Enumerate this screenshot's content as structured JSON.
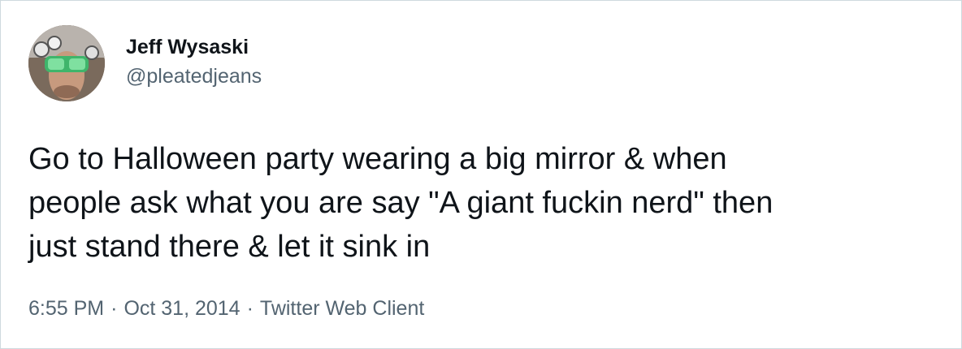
{
  "author": {
    "display_name": "Jeff Wysaski",
    "handle": "@pleatedjeans",
    "avatar_icon": "profile-photo"
  },
  "tweet": {
    "text": "Go to Halloween party wearing a big mirror & when\npeople ask what you are say \"A giant fuckin nerd\" then\njust stand there & let it sink in"
  },
  "meta": {
    "time": "6:55 PM",
    "separator": "·",
    "date": "Oct 31, 2014",
    "source": "Twitter Web Client"
  },
  "colors": {
    "text_primary": "#0f1419",
    "text_secondary": "#536471",
    "border": "#cfd9de"
  }
}
